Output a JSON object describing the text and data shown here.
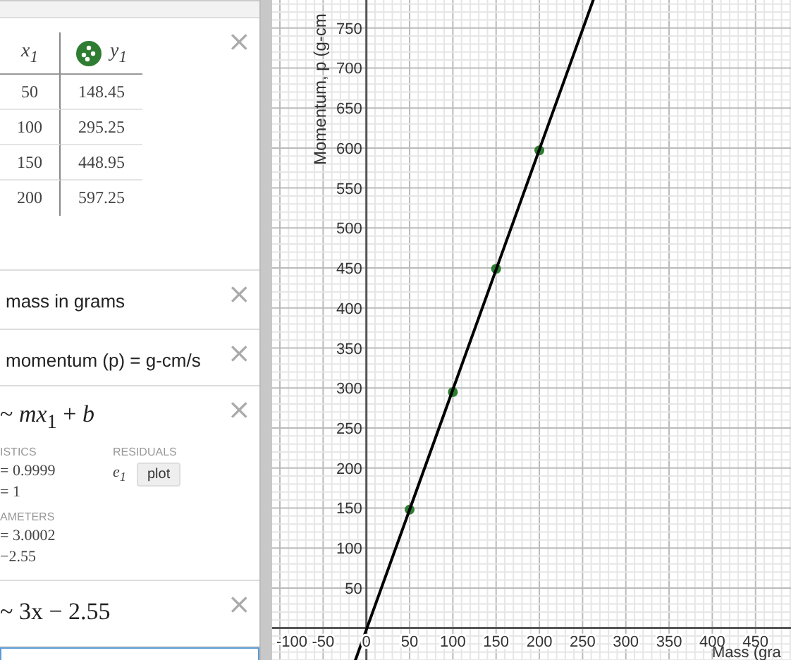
{
  "expressions": [
    {
      "kind": "table",
      "close": "×",
      "columns": [
        {
          "label": "x$_{1}$",
          "icon": false
        },
        {
          "label": "y$_{1}$",
          "icon": true
        }
      ],
      "rows": [
        [
          "50",
          "148.45"
        ],
        [
          "100",
          "295.25"
        ],
        [
          "150",
          "448.95"
        ],
        [
          "200",
          "597.25"
        ]
      ]
    },
    {
      "kind": "note",
      "close": "×",
      "text": "mass in grams"
    },
    {
      "kind": "note",
      "close": "×",
      "text": "momentum (p) = g-cm/s"
    },
    {
      "kind": "regression",
      "close": "×",
      "formula": "~ *mx*$_{1}$ + *b*",
      "statistics_heading": "ISTICS",
      "statistics": [
        "= 0.9999",
        "= 1"
      ],
      "residuals_heading": "RESIDUALS",
      "residual_var": "e$_{1}$",
      "plot_button": "plot",
      "parameters_heading": "AMETERS",
      "parameters": [
        "= 3.0002",
        "−2.55"
      ]
    },
    {
      "kind": "formula",
      "close": "×",
      "formula": "~ 3x − 2.55"
    },
    {
      "kind": "blank",
      "selected": true
    }
  ],
  "graph": {
    "chart_data": {
      "type": "scatter",
      "xlabel": "Mass (gra",
      "ylabel": "Momentum, p (g-cm",
      "grid": true,
      "xlim": [
        -109,
        491
      ],
      "ylim": [
        -40,
        785
      ],
      "x": [
        50,
        100,
        150,
        200
      ],
      "series": [
        {
          "color": "#2e7d32",
          "values": [
            148,
            295,
            449,
            597
          ]
        },
        {
          "type": "line",
          "color": "#000000",
          "values": [
            148,
            298,
            448,
            598
          ]
        }
      ],
      "xticks": [
        {
          "value": -100,
          "label": "-100"
        },
        {
          "value": -50,
          "label": "-50"
        },
        {
          "value": 0,
          "label": "0"
        },
        {
          "value": 50,
          "label": "50"
        },
        {
          "value": 100,
          "label": "100"
        },
        {
          "value": 150,
          "label": "150"
        },
        {
          "value": 200,
          "label": "200"
        },
        {
          "value": 250,
          "label": "250"
        },
        {
          "value": 300,
          "label": "300"
        },
        {
          "value": 350,
          "label": "350"
        },
        {
          "value": 400,
          "label": "400"
        },
        {
          "value": 450,
          "label": "450"
        }
      ],
      "yticks": [
        {
          "value": 50,
          "label": "50"
        },
        {
          "value": 100,
          "label": "100"
        },
        {
          "value": 150,
          "label": "150"
        },
        {
          "value": 200,
          "label": "200"
        },
        {
          "value": 250,
          "label": "250"
        },
        {
          "value": 300,
          "label": "300"
        },
        {
          "value": 350,
          "label": "350"
        },
        {
          "value": 400,
          "label": "400"
        },
        {
          "value": 450,
          "label": "450"
        },
        {
          "value": 500,
          "label": "500"
        },
        {
          "value": 550,
          "label": "550"
        },
        {
          "value": 600,
          "label": "600"
        },
        {
          "value": 650,
          "label": "650"
        },
        {
          "value": 700,
          "label": "700"
        },
        {
          "value": 750,
          "label": "750"
        }
      ]
    }
  }
}
